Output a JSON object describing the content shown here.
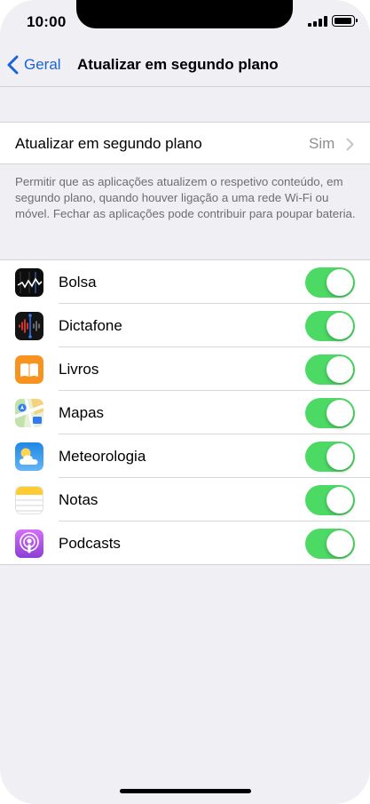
{
  "status_bar": {
    "time": "10:00",
    "signal_icon": "signal-bars-icon",
    "battery_icon": "battery-icon"
  },
  "nav": {
    "back_label": "Geral",
    "back_icon": "chevron-left-icon",
    "title": "Atualizar em segundo plano"
  },
  "background_refresh": {
    "label": "Atualizar em segundo plano",
    "value": "Sim",
    "chevron_icon": "chevron-right-icon"
  },
  "note": "Permitir que as aplicações atualizem o respetivo conteúdo, em segundo plano, quando houver ligação a uma rede Wi-Fi ou móvel. Fechar as aplicações pode contribuir para poupar bateria.",
  "apps": [
    {
      "name": "Bolsa",
      "icon": "stocks-icon",
      "enabled": true
    },
    {
      "name": "Dictafone",
      "icon": "voice-memos-icon",
      "enabled": true
    },
    {
      "name": "Livros",
      "icon": "books-icon",
      "enabled": true
    },
    {
      "name": "Mapas",
      "icon": "maps-icon",
      "enabled": true
    },
    {
      "name": "Meteorologia",
      "icon": "weather-icon",
      "enabled": true
    },
    {
      "name": "Notas",
      "icon": "notes-icon",
      "enabled": true
    },
    {
      "name": "Podcasts",
      "icon": "podcasts-icon",
      "enabled": true
    }
  ],
  "colors": {
    "accent": "#1a64d8",
    "toggle_on": "#4cd964",
    "background": "#efeff4"
  }
}
